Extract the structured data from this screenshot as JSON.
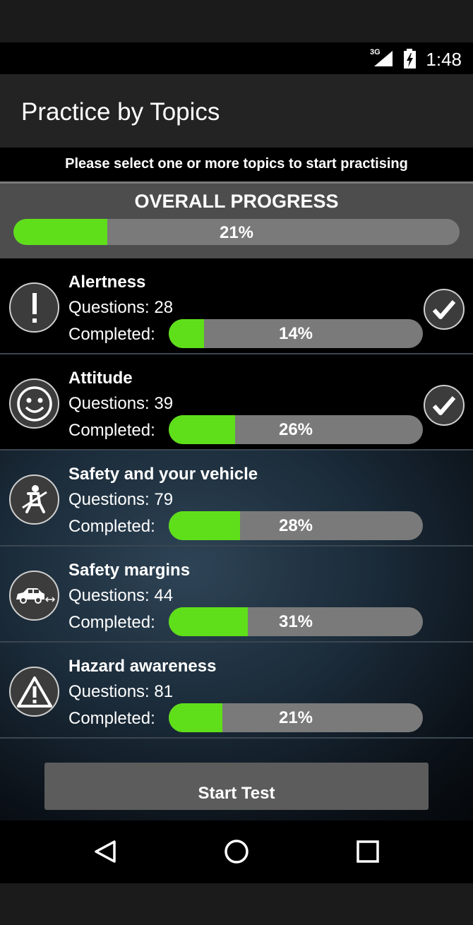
{
  "status_bar": {
    "network": "3G",
    "time": "1:48"
  },
  "app_bar": {
    "title": "Practice by Topics"
  },
  "subtitle": "Please select one or more topics to start practising",
  "overall": {
    "label": "OVERALL PROGRESS",
    "percent_text": "21%",
    "fraction": 0.21
  },
  "topics": [
    {
      "name": "Alertness",
      "questions": "Questions: 28",
      "completed_label": "Completed:",
      "percent_text": "14%",
      "fraction": 0.14,
      "icon": "exclamation-icon",
      "selected": true
    },
    {
      "name": "Attitude",
      "questions": "Questions: 39",
      "completed_label": "Completed:",
      "percent_text": "26%",
      "fraction": 0.26,
      "icon": "smiley-icon",
      "selected": true
    },
    {
      "name": "Safety and your vehicle",
      "questions": "Questions: 79",
      "completed_label": "Completed:",
      "percent_text": "28%",
      "fraction": 0.28,
      "icon": "seatbelt-icon",
      "selected": false
    },
    {
      "name": "Safety margins",
      "questions": "Questions: 44",
      "completed_label": "Completed:",
      "percent_text": "31%",
      "fraction": 0.31,
      "icon": "car-distance-icon",
      "selected": false
    },
    {
      "name": "Hazard awareness",
      "questions": "Questions: 81",
      "completed_label": "Completed:",
      "percent_text": "21%",
      "fraction": 0.21,
      "icon": "warning-triangle-icon",
      "selected": false
    }
  ],
  "start_button": "Start Test",
  "colors": {
    "progress_fill": "#5fdf1a",
    "progress_track": "#7a7a7a"
  }
}
